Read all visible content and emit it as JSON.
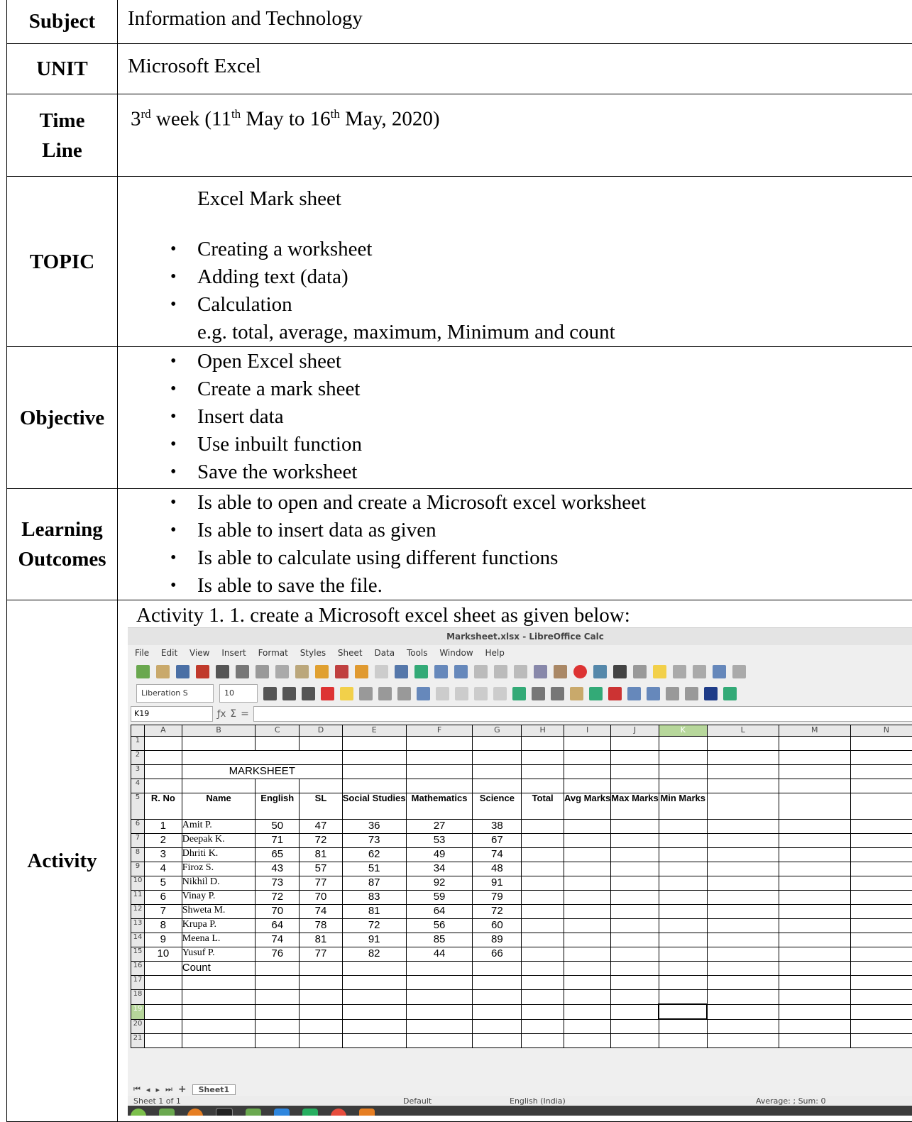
{
  "rows": {
    "subject": {
      "label": "Subject",
      "value": "Information and Technology"
    },
    "unit": {
      "label": "UNIT",
      "value": "Microsoft Excel"
    },
    "timeline": {
      "label1": "Time",
      "label2": "Line",
      "week_num": "3",
      "week_sup": "rd",
      "week_text": " week (11",
      "sup1": "th",
      "mid": " May  to 16",
      "sup2": "th",
      "end": "  May, 2020)"
    },
    "topic": {
      "label": "TOPIC",
      "title": "Excel Mark sheet",
      "bullets": [
        "Creating a worksheet",
        "Adding text (data)",
        "Calculation"
      ],
      "note": "e.g. total, average, maximum, Minimum and count"
    },
    "objective": {
      "label": "Objective",
      "bullets": [
        "Open Excel sheet",
        "Create a mark sheet",
        "Insert data",
        "Use inbuilt function",
        "Save the worksheet"
      ]
    },
    "outcomes": {
      "label1": "Learning",
      "label2": "Outcomes",
      "bullets": [
        "Is able to open and create a Microsoft excel worksheet",
        "Is able to insert data as given",
        "Is able to calculate using different functions",
        "Is able to save the file."
      ]
    },
    "activity": {
      "label": "Activity",
      "instruction": "Activity 1.  1. create a Microsoft excel sheet as given below:"
    }
  },
  "calc": {
    "title": "Marksheet.xlsx - LibreOffice Calc",
    "menu": [
      "File",
      "Edit",
      "View",
      "Insert",
      "Format",
      "Styles",
      "Sheet",
      "Data",
      "Tools",
      "Window",
      "Help"
    ],
    "font_name": "Liberation S",
    "font_size": "10",
    "cell_ref": "K19",
    "columns": [
      "A",
      "B",
      "C",
      "D",
      "E",
      "F",
      "G",
      "H",
      "I",
      "J",
      "K",
      "L",
      "M",
      "N"
    ],
    "sheet_title": "MARKSHEET",
    "headers": [
      "R. No",
      "Name",
      "English",
      "SL",
      "Social Studies",
      "Mathematics",
      "Science",
      "Total",
      "Avg Marks",
      "Max Marks",
      "Min Marks"
    ],
    "students": [
      [
        "1",
        "Amit P.",
        "50",
        "47",
        "36",
        "27",
        "38"
      ],
      [
        "2",
        "Deepak K.",
        "71",
        "72",
        "73",
        "53",
        "67"
      ],
      [
        "3",
        "Dhriti K.",
        "65",
        "81",
        "62",
        "49",
        "74"
      ],
      [
        "4",
        "Firoz S.",
        "43",
        "57",
        "51",
        "34",
        "48"
      ],
      [
        "5",
        "Nikhil D.",
        "73",
        "77",
        "87",
        "92",
        "91"
      ],
      [
        "6",
        "Vinay P.",
        "72",
        "70",
        "83",
        "59",
        "79"
      ],
      [
        "7",
        "Shweta M.",
        "70",
        "74",
        "81",
        "64",
        "72"
      ],
      [
        "8",
        "Krupa  P.",
        "64",
        "78",
        "72",
        "56",
        "60"
      ],
      [
        "9",
        "Meena L.",
        "74",
        "81",
        "91",
        "85",
        "89"
      ],
      [
        "10",
        "Yusuf P.",
        "76",
        "77",
        "82",
        "44",
        "66"
      ]
    ],
    "count_label": "Count",
    "sheet_tab": "Sheet1",
    "status_sheet": "Sheet 1 of 1",
    "status_style": "Default",
    "status_lang": "English (India)",
    "status_sum": "Average: ; Sum: 0"
  }
}
